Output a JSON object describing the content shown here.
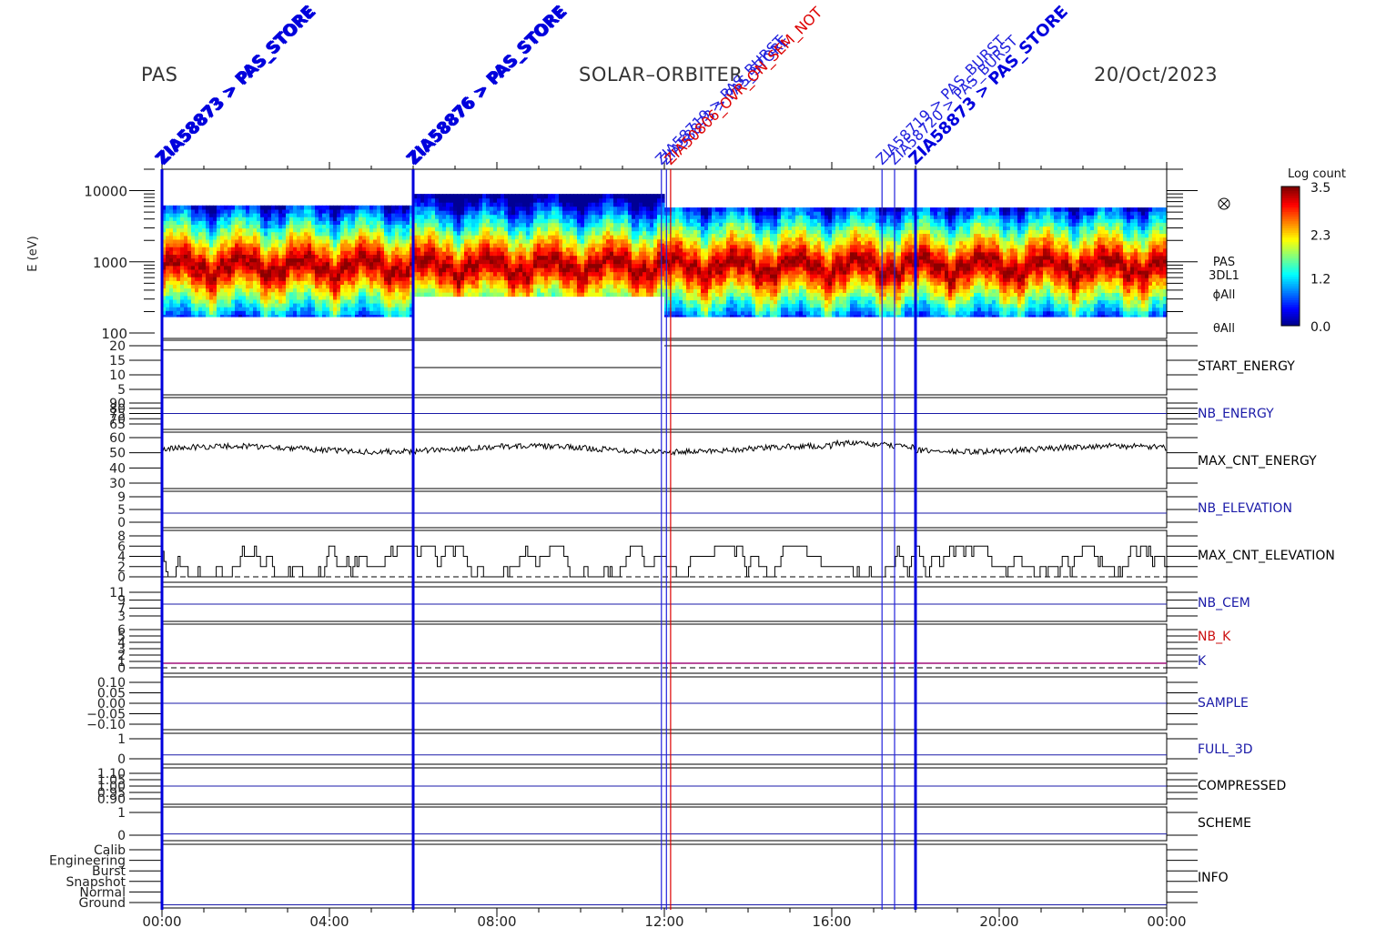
{
  "header": {
    "instrument": "PAS",
    "mission": "SOLAR–ORBITER",
    "date": "20/Oct/2023"
  },
  "chart_data": {
    "type": "spectrogram_stackplot",
    "x_ticks": [
      "00:00",
      "04:00",
      "08:00",
      "12:00",
      "16:00",
      "20:00",
      "00:00"
    ],
    "spectrogram": {
      "ylabel": "E (eV)",
      "y_ticks": [
        "10000",
        "1000",
        "100"
      ],
      "ylim": [
        100,
        20000
      ],
      "right_labels": [
        "PAS",
        "3DL1",
        "ϕAll",
        "θAll"
      ],
      "colorbar": {
        "title": "Log count",
        "ticks": [
          "3.5",
          "2.3",
          "1.2",
          "0.0"
        ],
        "range": [
          0.0,
          3.5
        ]
      }
    },
    "panels": [
      {
        "label": "START_ENERGY",
        "label_color": "#000000",
        "y_ticks": [
          "20",
          "15",
          "10",
          "5"
        ]
      },
      {
        "label": "NB_ENERGY",
        "label_color": "#1a1aa8",
        "y_ticks": [
          "90",
          "80",
          "75",
          "70",
          "65"
        ]
      },
      {
        "label": "MAX_CNT_ENERGY",
        "label_color": "#000000",
        "y_ticks": [
          "60",
          "50",
          "40",
          "30"
        ]
      },
      {
        "label": "NB_ELEVATION",
        "label_color": "#1a1aa8",
        "y_ticks": [
          "9",
          "5",
          "0"
        ]
      },
      {
        "label": "MAX_CNT_ELEVATION",
        "label_color": "#000000",
        "y_ticks": [
          "8",
          "6",
          "4",
          "2",
          "0"
        ]
      },
      {
        "label": "NB_CEM",
        "label_color": "#1a1aa8",
        "y_ticks": [
          "11",
          "9",
          "7",
          "3"
        ]
      },
      {
        "label": "NB_K",
        "label_color": "#cc1111",
        "second_label": "K",
        "second_label_color": "#1a1aa8",
        "y_ticks": [
          "6",
          "5",
          "4",
          "3",
          "2",
          "1",
          "0"
        ]
      },
      {
        "label": "SAMPLE",
        "label_color": "#1a1aa8",
        "y_ticks": [
          "0.10",
          "0.05",
          "0.00",
          "−0.05",
          "−0.10"
        ]
      },
      {
        "label": "FULL_3D",
        "label_color": "#1a1aa8",
        "y_ticks": [
          "1",
          "0"
        ]
      },
      {
        "label": "COMPRESSED",
        "label_color": "#000000",
        "y_ticks": [
          "1.10",
          "1.05",
          "1.00",
          "0.95",
          "0.90"
        ]
      },
      {
        "label": "SCHEME",
        "label_color": "#000000",
        "y_ticks": [
          "1",
          "0"
        ]
      },
      {
        "label": "INFO",
        "label_color": "#000000",
        "y_ticks": [
          "Calib",
          "Engineering",
          "Burst",
          "Snapshot",
          "Normal",
          "Ground"
        ]
      }
    ],
    "start_energy_levels": [
      {
        "from": "00:00",
        "to": "06:00",
        "value": 18
      },
      {
        "from": "06:00",
        "to": "11:55",
        "value": 10
      },
      {
        "from": "12:00",
        "to": "24:00",
        "value": 20
      }
    ],
    "events": [
      {
        "time_hours": 0.0,
        "color": "#0000dd",
        "labels": [
          "ZIA58873 > PAS_STORE",
          "ZIA58873 > PAS_STORE"
        ]
      },
      {
        "time_hours": 6.0,
        "color": "#0000dd",
        "labels": [
          "ZIA58876 > PAS_STORE",
          "ZIA58876 > PAS_STORE"
        ]
      },
      {
        "time_hours": 11.93,
        "color": "#2222dd",
        "labels": [
          "ZIA58719 > PAS_BURST"
        ]
      },
      {
        "time_hours": 12.05,
        "color": "#2222dd",
        "labels": [
          "ZIA58873 > PAS_STORE"
        ]
      },
      {
        "time_hours": 12.15,
        "color": "#dd0000",
        "labels": [
          "ZIA50806_OVR_ON_SEM_NOT"
        ]
      },
      {
        "time_hours": 17.2,
        "color": "#2222dd",
        "labels": [
          "ZIA58719 > PAS_BURST"
        ]
      },
      {
        "time_hours": 17.5,
        "color": "#2222dd",
        "labels": [
          "ZIA58720 > PAS_BURST"
        ]
      },
      {
        "time_hours": 18.0,
        "color": "#0000dd",
        "labels": [
          "ZIA58873 > PAS_STORE"
        ]
      }
    ]
  }
}
